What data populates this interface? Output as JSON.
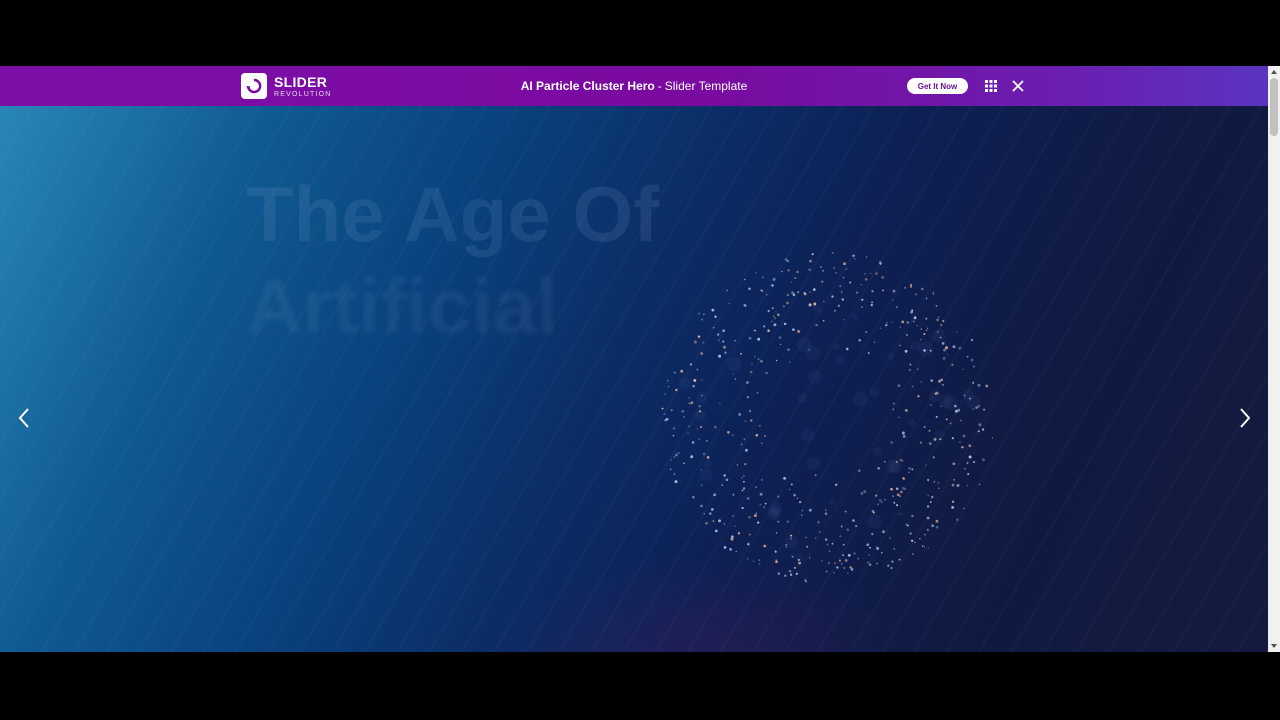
{
  "topbar": {
    "logo_main": "SLIDER",
    "logo_sub": "REVOLUTION",
    "title_strong": "AI Particle Cluster Hero",
    "title_sep": "-",
    "title_rest": "Slider Template",
    "get_button": "Get It Now",
    "icons": [
      "grid-icon",
      "close-icon"
    ]
  },
  "slide": {
    "headline_line1": "The Age Of",
    "headline_line2": "Artificial"
  },
  "navigation": {
    "prev_icon": "chevron-left-icon",
    "next_icon": "chevron-right-icon"
  },
  "colors": {
    "bar_purple": "#7d0fa8",
    "button_text": "#6b0f97",
    "slide_blue": "#0a4380",
    "slide_navy": "#131a3d"
  }
}
